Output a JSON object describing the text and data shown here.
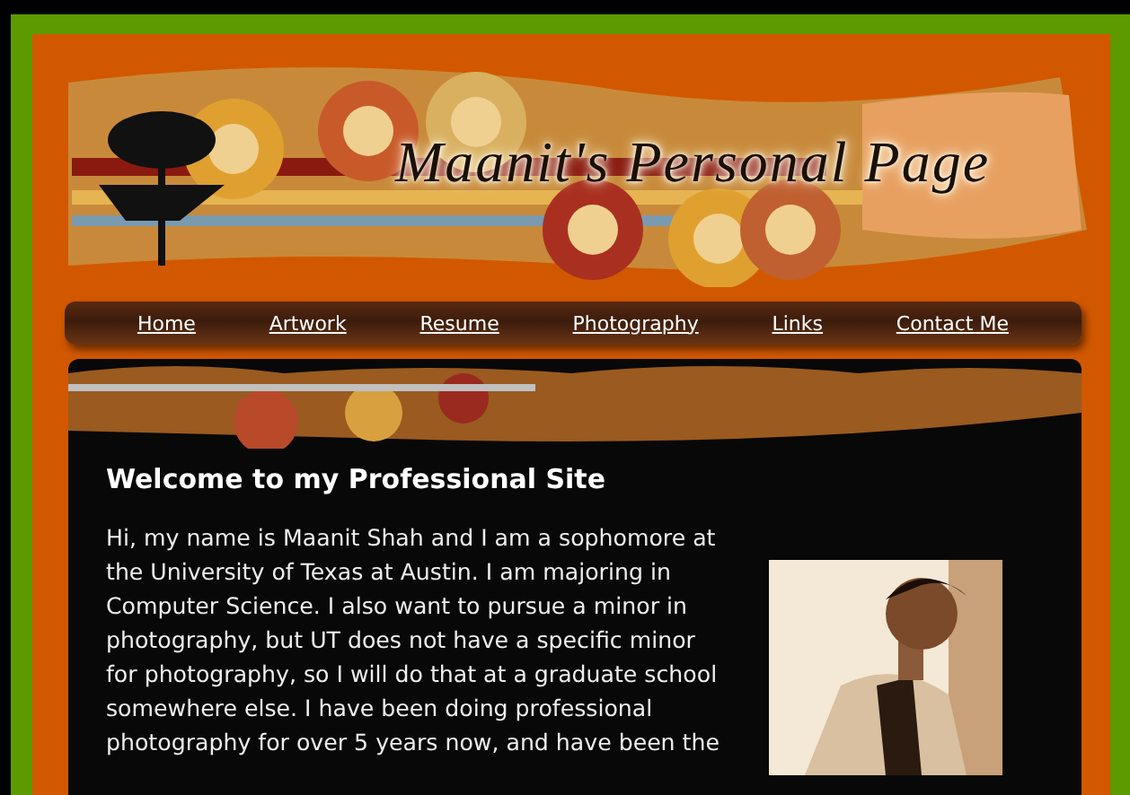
{
  "banner": {
    "title": "Maanit's Personal Page",
    "kind": "picture"
  },
  "nav": [
    {
      "label": "Home"
    },
    {
      "label": "Artwork"
    },
    {
      "label": "Resume"
    },
    {
      "label": "Photography"
    },
    {
      "label": "Links"
    },
    {
      "label": "Contact Me"
    }
  ],
  "content": {
    "heading": "Welcome to my Professional Site",
    "paragraph": "Hi, my name is Maanit Shah and I am a sophomore at the University of Texas at Austin. I am majoring in Computer Science. I also want to pursue a minor in photography, but UT does not have a specific minor for photography, so I will do that at a graduate school somewhere else. I have been doing professional photography for over 5 years now, and have been the"
  }
}
